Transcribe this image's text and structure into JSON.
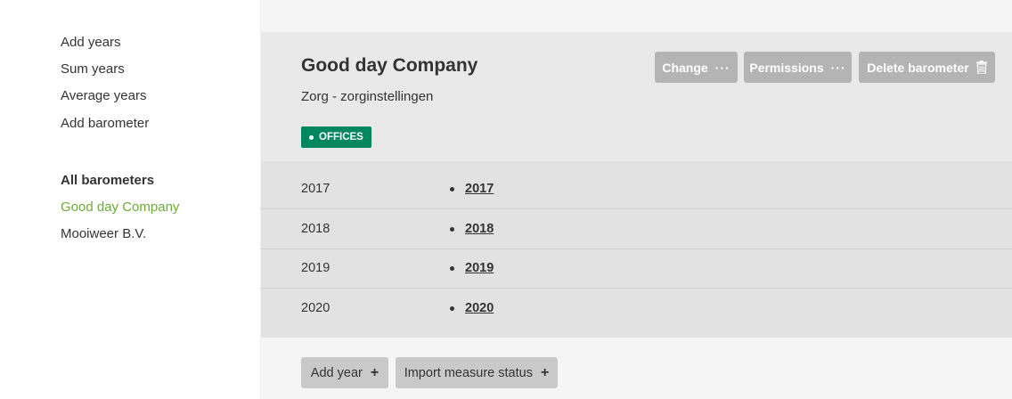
{
  "sidebar": {
    "links": [
      "Add years",
      "Sum years",
      "Average years",
      "Add barometer"
    ],
    "section_heading": "All barometers",
    "barometers": [
      "Good day Company",
      "Mooiweer B.V."
    ]
  },
  "company": {
    "title": "Good day Company",
    "subtitle": "Zorg - zorginstellingen",
    "tag": "OFFICES"
  },
  "toolbar": {
    "change_label": "Change",
    "permissions_label": "Permissions",
    "delete_label": "Delete barometer",
    "more_glyph": "···"
  },
  "years": [
    {
      "label": "2017",
      "link": "2017"
    },
    {
      "label": "2018",
      "link": "2018"
    },
    {
      "label": "2019",
      "link": "2019"
    },
    {
      "label": "2020",
      "link": "2020"
    }
  ],
  "actions": {
    "add_year_label": "Add year",
    "import_label": "Import measure status",
    "plus_glyph": "+"
  },
  "colors": {
    "active_link": "#6aab3a",
    "tag_bg": "#00875f",
    "button_bg": "#b4b4b4"
  }
}
